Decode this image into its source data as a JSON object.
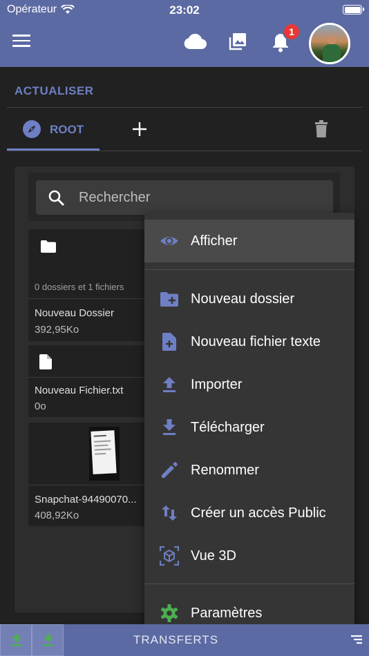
{
  "status_bar": {
    "carrier": "Opérateur",
    "time": "23:02"
  },
  "app_bar": {
    "notification_count": "1"
  },
  "refresh_label": "ACTUALISER",
  "tabs": {
    "root_label": "ROOT"
  },
  "search": {
    "placeholder": "Rechercher"
  },
  "files": [
    {
      "meta": "0 dossiers et 1 fichiers",
      "name": "Nouveau Dossier",
      "size": "392,95Ko",
      "type": "folder"
    },
    {
      "name": "Nouveau Fichier.txt",
      "size": "0o",
      "type": "file"
    },
    {
      "name": "Snapchat-94490070...",
      "size": "408,92Ko",
      "type": "image"
    }
  ],
  "context_menu": {
    "items": [
      {
        "label": "Afficher",
        "icon": "eye-icon"
      },
      {
        "label": "Nouveau dossier",
        "icon": "folder-plus-icon"
      },
      {
        "label": "Nouveau fichier texte",
        "icon": "file-plus-icon"
      },
      {
        "label": "Importer",
        "icon": "upload-icon"
      },
      {
        "label": "Télécharger",
        "icon": "download-icon"
      },
      {
        "label": "Renommer",
        "icon": "pencil-icon"
      },
      {
        "label": "Créer un accès Public",
        "icon": "swap-vertical-icon"
      },
      {
        "label": "Vue 3D",
        "icon": "cube-icon"
      },
      {
        "label": "Paramètres",
        "icon": "gear-icon"
      }
    ]
  },
  "bottom_bar": {
    "transfers_label": "TRANSFERTS"
  },
  "colors": {
    "primary": "#5c6aa3",
    "accent": "#6e7fc4",
    "success": "#4caf50",
    "badge": "#e53935",
    "background": "#212121"
  }
}
